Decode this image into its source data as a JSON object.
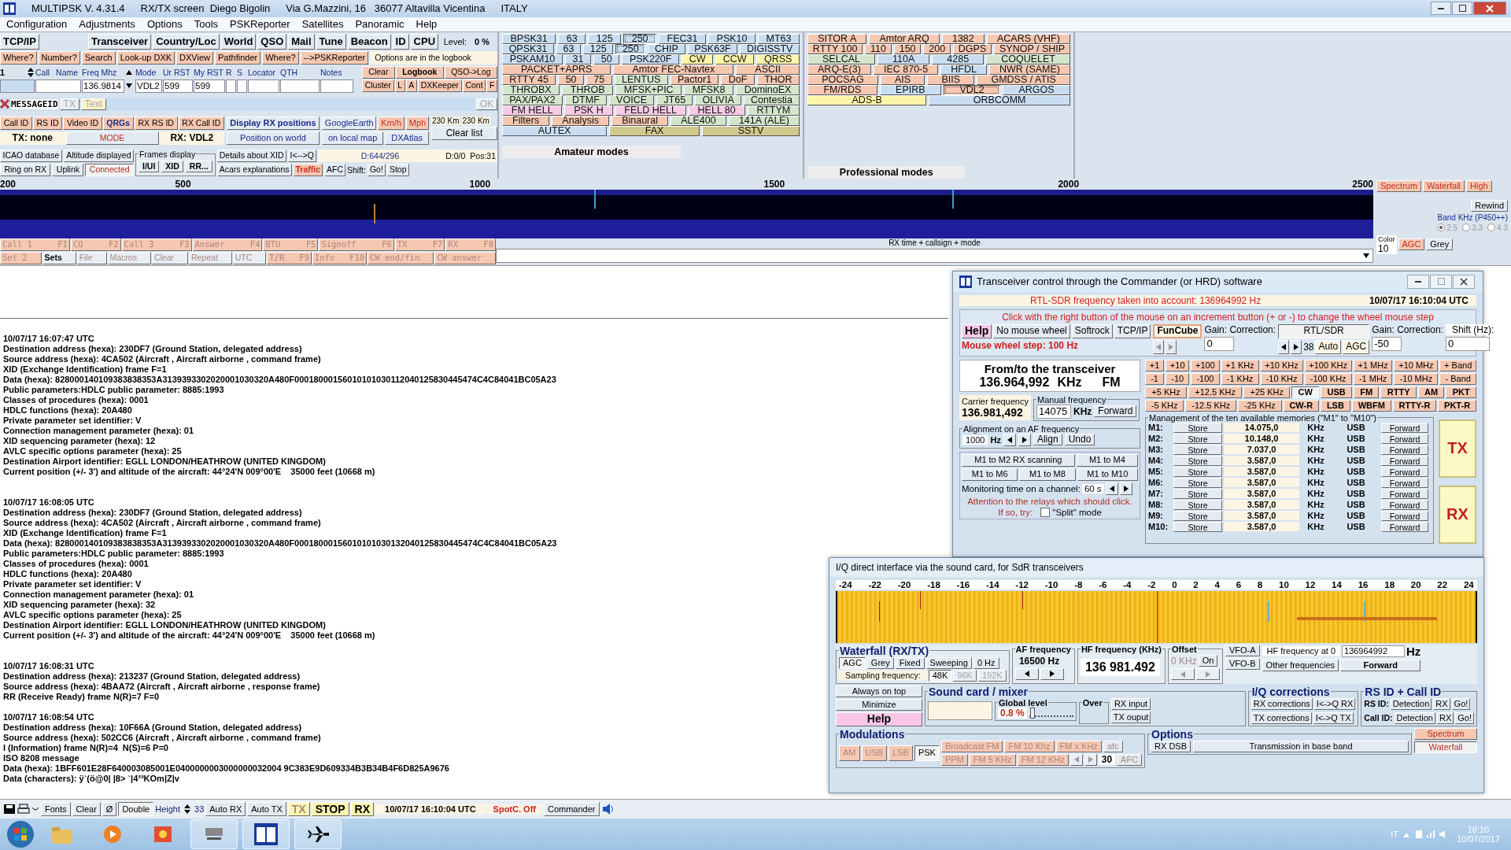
{
  "window": {
    "title_parts": [
      "MULTIPSK V. 4.31.4",
      "RX/TX screen  Diego Bigolin",
      "Via G.Mazzini, 16   36077 Altavilla Vicentina",
      "ITALY"
    ]
  },
  "menu": [
    "Configuration",
    "Adjustments",
    "Options",
    "Tools",
    "PSKReporter",
    "Satellites",
    "Panoramic",
    "Help"
  ],
  "toolbar": {
    "buttons": [
      "TCP/IP",
      "Transceiver",
      "Country/Loc",
      "World",
      "QSO",
      "Mail",
      "Tune",
      "Beacon",
      "ID",
      "CPU"
    ],
    "level_label": "Level:",
    "level_value": "0 %"
  },
  "log_buttons": [
    "Where?",
    "Number?",
    "Search",
    "Look-up DXK",
    "DXView",
    "Pathfinder",
    "Where?",
    "-->PSKReporter"
  ],
  "options_note": "Options are in the logbook",
  "qso": {
    "number": "1",
    "columns": [
      "Call",
      "Name",
      "Freq Mhz",
      "Mode",
      "Ur RST",
      "My RST",
      "R",
      "S",
      "Locator",
      "QTH",
      "Notes"
    ],
    "freq": "136.9814",
    "mode": "VDL2",
    "ur_rst": "599",
    "my_rst": "599"
  },
  "logbook_buttons": [
    [
      "Clear",
      "Logbook",
      "QSO->Log"
    ],
    [
      "Cluster",
      "L",
      "A",
      "DXKeeper",
      "Cont",
      "F"
    ]
  ],
  "message": {
    "label": "MESSAGEID",
    "tx": "TX",
    "text": "Text",
    "ok": "OK"
  },
  "id_buttons": [
    "Call ID",
    "RS ID",
    "Video ID",
    "QRGs",
    "RX RS ID",
    "RX Call ID"
  ],
  "tx_state": "TX: none",
  "mode_button": "MODE",
  "rx_state": "RX: VDL2",
  "map": {
    "display": "Display RX positions",
    "world": "Position on world",
    "google": "GoogleEarth",
    "kmh": "Km/h",
    "mph": "Mph",
    "local": "on local map",
    "dxatlas": "DXAtlas",
    "dist1": "230 Km",
    "dist2": "230 Km",
    "clear": "Clear list"
  },
  "frames": {
    "icao": "ICAO database",
    "altitude": "Altitude displayed",
    "ring": "Ring on RX",
    "uplink": "Uplink",
    "connected": "Connected",
    "title": "Frames display",
    "buttons": [
      "I/UI",
      "XID",
      "RR..."
    ],
    "details": "Details about XID",
    "iq": "I<-->Q",
    "acars": "Acars explanations",
    "traffic": "Traffic",
    "afc": "AFC",
    "shift": "Shift:",
    "go": "Go!",
    "stop": "Stop",
    "d1": "D:644/296",
    "d2": "D:0/0",
    "pos": "Pos:31"
  },
  "amateur": {
    "title": "Amateur modes",
    "rows": [
      {
        "buttons": [
          {
            "label": "BPSK31",
            "color": "#c9ddf2",
            "selected": false
          },
          {
            "label": "63",
            "color": "#c9ddf2",
            "selected": false
          },
          {
            "label": "125",
            "color": "#c9ddf2",
            "selected": false
          },
          {
            "label": "250",
            "color": "#c9ddf2",
            "selected": true
          },
          {
            "label": "FEC31",
            "color": "#c9ddf2",
            "selected": false
          },
          {
            "label": "PSK10",
            "color": "#c9ddf2",
            "selected": false
          },
          {
            "label": "MT63",
            "color": "#c9ddf2",
            "selected": false
          }
        ]
      },
      {
        "buttons": [
          {
            "label": "QPSK31",
            "color": "#c9ddf2",
            "selected": false
          },
          {
            "label": "63",
            "color": "#c9ddf2",
            "selected": false
          },
          {
            "label": "125",
            "color": "#c9ddf2",
            "selected": false
          },
          {
            "label": "250",
            "color": "#c9ddf2",
            "selected": true
          },
          {
            "label": "CHIP",
            "color": "#c9ddf2",
            "selected": false
          },
          {
            "label": "PSK63F",
            "color": "#c9ddf2",
            "selected": false
          },
          {
            "label": "DIGISSTV",
            "color": "#c9ddf2",
            "selected": false
          }
        ]
      },
      {
        "buttons": [
          {
            "label": "PSKAM10",
            "color": "#c9ddf2",
            "selected": false
          },
          {
            "label": "31",
            "color": "#c9ddf2",
            "selected": false
          },
          {
            "label": "50",
            "color": "#c9ddf2",
            "selected": false
          },
          {
            "label": "PSK220F",
            "color": "#c9ddf2",
            "selected": false
          },
          {
            "label": "CW",
            "color": "#fdf6a8",
            "selected": false
          },
          {
            "label": "CCW",
            "color": "#fdf6a8",
            "selected": false
          },
          {
            "label": "QRSS",
            "color": "#fdf6a8",
            "selected": false
          }
        ]
      },
      {
        "buttons": [
          {
            "label": "PACKET+APRS",
            "color": "#f6c7b1",
            "selected": false
          },
          {
            "label": "Amtor FEC-Navtex",
            "color": "#f6c7b1",
            "selected": false
          },
          {
            "label": "ASCII",
            "color": "#f6c7b1",
            "selected": false
          }
        ]
      },
      {
        "buttons": [
          {
            "label": "RTTY 45",
            "color": "#f6c7b1",
            "selected": false
          },
          {
            "label": "50",
            "color": "#f6c7b1",
            "selected": false
          },
          {
            "label": "75",
            "color": "#f6c7b1",
            "selected": false
          },
          {
            "label": "LENTUS",
            "color": "#d3e6cc",
            "selected": false
          },
          {
            "label": "Pactor1",
            "color": "#f6c7b1",
            "selected": false
          },
          {
            "label": "DoF",
            "color": "#f6c7b1",
            "selected": false
          },
          {
            "label": "THOR",
            "color": "#f6c7b1",
            "selected": false
          }
        ]
      },
      {
        "buttons": [
          {
            "label": "THROBX",
            "color": "#d3e6cc",
            "selected": false
          },
          {
            "label": "THROB",
            "color": "#d3e6cc",
            "selected": false
          },
          {
            "label": "MFSK+PIC",
            "color": "#d3e6cc",
            "selected": false
          },
          {
            "label": "MFSK8",
            "color": "#d3e6cc",
            "selected": false
          },
          {
            "label": "DominoEX",
            "color": "#d3e6cc",
            "selected": false
          }
        ]
      },
      {
        "buttons": [
          {
            "label": "PAX/PAX2",
            "color": "#d3e6cc",
            "selected": false
          },
          {
            "label": "DTMF",
            "color": "#d3e6cc",
            "selected": false
          },
          {
            "label": "VOICE",
            "color": "#d3e6cc",
            "selected": false
          },
          {
            "label": "JT65",
            "color": "#d3e6cc",
            "selected": false
          },
          {
            "label": "OLIVIA",
            "color": "#d3e6cc",
            "selected": false
          },
          {
            "label": "Contestia",
            "color": "#d3e6cc",
            "selected": false
          }
        ]
      },
      {
        "buttons": [
          {
            "label": "FM HELL",
            "color": "#f9cbe6",
            "selected": false
          },
          {
            "label": "PSK H",
            "color": "#f9cbe6",
            "selected": false
          },
          {
            "label": "FELD HELL",
            "color": "#f9cbe6",
            "selected": false
          },
          {
            "label": "HELL 80",
            "color": "#f9cbe6",
            "selected": false
          },
          {
            "label": "RTTYM",
            "color": "#d3e6cc",
            "selected": false
          }
        ]
      },
      {
        "buttons": [
          {
            "label": "Filters",
            "color": "#f6c7b1",
            "selected": false
          },
          {
            "label": "Analysis",
            "color": "#f6c7b1",
            "selected": false
          },
          {
            "label": "Binaural",
            "color": "#f6c7b1",
            "selected": false
          },
          {
            "label": "ALE400",
            "color": "#d3e6cc",
            "selected": false
          },
          {
            "label": "141A (ALE)",
            "color": "#d3e6cc",
            "selected": false
          }
        ]
      },
      {
        "buttons": [
          {
            "label": "AUTEX",
            "color": "#c9ddf2",
            "selected": false
          },
          {
            "label": "FAX",
            "color": "#d2c98f",
            "selected": false
          },
          {
            "label": "SSTV",
            "color": "#d2c98f",
            "selected": false
          }
        ]
      }
    ]
  },
  "professional": {
    "title": "Professional modes",
    "rows": [
      {
        "buttons": [
          {
            "label": "SITOR A",
            "color": "#f6c7b1",
            "selected": false
          },
          {
            "label": "Amtor ARQ",
            "color": "#f6c7b1",
            "selected": false
          },
          {
            "label": "1382",
            "color": "#f6c7b1",
            "selected": false
          },
          {
            "label": "ACARS (VHF)",
            "color": "#f6c7b1",
            "selected": false
          }
        ]
      },
      {
        "buttons": [
          {
            "label": "RTTY 100",
            "color": "#f6c7b1",
            "selected": false
          },
          {
            "label": "110",
            "color": "#f6c7b1",
            "selected": false
          },
          {
            "label": "150",
            "color": "#f6c7b1",
            "selected": false
          },
          {
            "label": "200",
            "color": "#f6c7b1",
            "selected": false
          },
          {
            "label": "DGPS",
            "color": "#f6c7b1",
            "selected": false
          },
          {
            "label": "SYNOP / SHIP",
            "color": "#f6c7b1",
            "selected": false
          }
        ]
      },
      {
        "buttons": [
          {
            "label": "SELCAL",
            "color": "#d3e6cc",
            "selected": false
          },
          {
            "label": "110A",
            "color": "#c9ddf2",
            "selected": false
          },
          {
            "label": "4285",
            "color": "#c9ddf2",
            "selected": false
          },
          {
            "label": "COQUELET",
            "color": "#d3e6cc",
            "selected": false
          }
        ]
      },
      {
        "buttons": [
          {
            "label": "ARQ-E(3)",
            "color": "#f6c7b1",
            "selected": false
          },
          {
            "label": "IEC 870-5",
            "color": "#f6c7b1",
            "selected": false
          },
          {
            "label": "HFDL",
            "color": "#c9ddf2",
            "selected": false
          },
          {
            "label": "NWR (SAME)",
            "color": "#f6c7b1",
            "selected": false
          }
        ]
      },
      {
        "buttons": [
          {
            "label": "POCSAG",
            "color": "#f6c7b1",
            "selected": false
          },
          {
            "label": "AIS",
            "color": "#f6c7b1",
            "selected": false
          },
          {
            "label": "BIIS",
            "color": "#f6c7b1",
            "selected": false
          },
          {
            "label": "GMDSS / ATIS",
            "color": "#f6c7b1",
            "selected": false
          }
        ]
      },
      {
        "buttons": [
          {
            "label": "FM/RDS",
            "color": "#f6c7b1",
            "selected": false
          },
          {
            "label": "EPIRB",
            "color": "#c9ddf2",
            "selected": false
          },
          {
            "label": "VDL2",
            "color": "#f6c7b1",
            "selected": true
          },
          {
            "label": "ARGOS",
            "color": "#c9ddf2",
            "selected": false
          }
        ]
      },
      {
        "buttons": [
          {
            "label": "ADS-B",
            "color": "#fdf6a8",
            "selected": false
          },
          {
            "label": "ORBCOMM",
            "color": "#c9ddf2",
            "selected": false
          }
        ]
      }
    ]
  },
  "scale": [
    "200",
    "500",
    "1000",
    "1500",
    "2000",
    "2500"
  ],
  "wf_side": {
    "views": [
      "Spectrum",
      "Waterfall",
      "High"
    ],
    "rewind": "Rewind",
    "band_label": "Band KHz (P450++)",
    "bands": [
      {
        "label": "2.5",
        "selected": true
      },
      {
        "label": "3.3",
        "selected": false
      },
      {
        "label": "4.3",
        "selected": false
      }
    ],
    "color_label": "Color",
    "color_value": "10",
    "agc": "AGC",
    "grey": "Grey"
  },
  "macros": [
    [
      {
        "label": "Call 1",
        "key": "F1"
      },
      {
        "label": "CQ",
        "key": "F2"
      },
      {
        "label": "Call 3",
        "key": "F3"
      },
      {
        "label": "Answer",
        "key": "F4"
      },
      {
        "label": "BTU",
        "key": "F5"
      },
      {
        "label": "Signoff",
        "key": "F6"
      },
      {
        "label": "TX",
        "key": "F7"
      },
      {
        "label": "RX",
        "key": "F8"
      }
    ],
    [
      {
        "label": "Set 2"
      },
      {
        "label": "Sets"
      },
      {
        "label": "File"
      },
      {
        "label": "Macros"
      },
      {
        "label": "Clear"
      },
      {
        "label": "Repeat"
      },
      {
        "label": "UTC"
      },
      {
        "label": "T/R",
        "key": "F9"
      },
      {
        "label": "Info",
        "key": "F10"
      },
      {
        "label": "CW end/fin"
      },
      {
        "label": "CW answer"
      }
    ]
  ],
  "rx_time_label": "RX time + callsign + mode",
  "log": [
    {
      "lines": [
        "10/07/17 16:07:47 UTC",
        "Destination address (hexa): 230DF7 (Ground Station, delegated address)",
        "Source address (hexa): 4CA502 (Aircraft , Aircraft airborne , command frame)",
        "XID (Exchange Identification) frame F=1",
        "Data (hexa): 828000140109383838353A3139393302020001030320A480F00018000156010101030112040125830445474C4C84041BC05A23",
        "Public parameters:HDLC public parameter: 8885:1993",
        "Classes of procedures (hexa): 0001",
        "HDLC functions (hexa): 20A480",
        "Private parameter set identifier: V",
        "Connection management parameter (hexa): 01",
        "XID sequencing parameter (hexa): 12",
        "AVLC specific options parameter (hexa): 25",
        "Destination Airport identifier: EGLL LONDON/HEATHROW (UNITED KINGDOM)",
        "Current position (+/- 3') and altitude of the aircraft: 44°24'N 009°00'E    35000 feet (10668 m)"
      ]
    },
    {
      "lines": [
        "10/07/17 16:08:05 UTC",
        "Destination address (hexa): 230DF7 (Ground Station, delegated address)",
        "Source address (hexa): 4CA502 (Aircraft , Aircraft airborne , command frame)",
        "XID (Exchange Identification) frame F=1",
        "Data (hexa): 828000140109383838353A3139393302020001030320A480F00018000156010101030132040125830445474C4C84041BC05A23",
        "Public parameters:HDLC public parameter: 8885:1993",
        "Classes of procedures (hexa): 0001",
        "HDLC functions (hexa): 20A480",
        "Private parameter set identifier: V",
        "Connection management parameter (hexa): 01",
        "XID sequencing parameter (hexa): 32",
        "AVLC specific options parameter (hexa): 25",
        "Destination Airport identifier: EGLL LONDON/HEATHROW (UNITED KINGDOM)",
        "Current position (+/- 3') and altitude of the aircraft: 44°24'N 009°00'E    35000 feet (10668 m)"
      ]
    },
    {
      "lines": [
        "10/07/17 16:08:31 UTC",
        "Destination address (hexa): 213237 (Ground Station, delegated address)",
        "Source address (hexa): 4BAA72 (Aircraft , Aircraft airborne , response frame)",
        "RR (Receive Ready) frame N(R)=7 F=0"
      ]
    },
    {
      "lines": [
        "10/07/17 16:08:54 UTC",
        "Destination address (hexa): 10F66A (Ground Station, delegated address)",
        "Source address (hexa): 502CC6 (Aircraft , Aircraft airborne , command frame)",
        "I (Information) frame N(R)=4  N(S)=6 P=0",
        "ISO 8208 message",
        "Data (hexa): 1BFF601E28F640003085001E0400000003000000032004 9C383E9D609334B3B34B4F6D825A9676",
        "Data (characters): ÿ`(ö@0| |8> `|4³³KOm|Z|v"
      ]
    }
  ],
  "transceiver": {
    "title": "Transceiver control through the Commander (or HRD) software",
    "rtl_info": "RTL-SDR frequency taken into account: 136964992 Hz",
    "datetime": "10/07/17 16:10:04 UTC",
    "hint": "Click with the right button of the mouse on an increment button (+ or -) to change the wheel mouse step",
    "help": "Help",
    "interfaces": [
      "No mouse wheel",
      "Softrock",
      "TCP/IP"
    ],
    "wheel_step": "Mouse wheel step: 100 Hz",
    "funcube": "FunCube",
    "gain_label": "Gain: Correction:",
    "gain_value": "0",
    "rtl": "RTL/SDR",
    "rtl_num": "38",
    "auto": "Auto",
    "agc": "AGC",
    "gain2_label": "Gain: Correction:",
    "gain2_value": "-50",
    "shift_label": "Shift (Hz):",
    "shift_value": "0",
    "from_to": "From/to the transceiver",
    "freq": "136.964,992",
    "freq_unit": "KHz",
    "mode": "FM",
    "carrier_label": "Carrier frequency",
    "carrier": "136.981,492",
    "manual_label": "Manual frequency",
    "manual_value": "14075",
    "manual_unit": "KHz",
    "forward": "Forward",
    "align_label": "Alignment on an AF frequency",
    "align_value": "1000",
    "align_unit": "Hz",
    "align": "Align",
    "undo": "Undo",
    "scan_buttons": [
      [
        "M1 to M2 RX scanning",
        "M1 to M4"
      ],
      [
        "M1 to M6",
        "M1 to M8",
        "M1 to M10"
      ]
    ],
    "monitor_label": "Monitoring time on a channel:",
    "monitor_value": "60 s",
    "attention": "Attention to the relays which should click.",
    "ifso": "If so, try:",
    "split": {
      "label": "\"Split\" mode",
      "checked": false
    },
    "inc_rows": [
      [
        "+1",
        "+10",
        "+100",
        "+1 KHz",
        "+10 KHz",
        "+100 KHz",
        "+1 MHz",
        "+10 MHz",
        "+ Band"
      ],
      [
        "-1",
        "-10",
        "-100",
        "-1 KHz",
        "-10 KHz",
        "-100 KHz",
        "-1 MHz",
        "-10 MHz",
        "- Band"
      ]
    ],
    "step_rows": [
      [
        "+5 KHz",
        "+12.5 KHz",
        "+25 KHz"
      ],
      [
        "-5 KHz",
        "-12.5 KHz",
        "-25 KHz"
      ]
    ],
    "mode_rows": [
      [
        {
          "label": "CW",
          "selected": true
        },
        {
          "label": "USB",
          "selected": false
        },
        {
          "label": "FM",
          "selected": false
        },
        {
          "label": "RTTY",
          "selected": false
        },
        {
          "label": "AM",
          "selected": false
        },
        {
          "label": "PKT",
          "selected": false
        }
      ],
      [
        {
          "label": "CW-R",
          "selected": false
        },
        {
          "label": "LSB",
          "selected": false
        },
        {
          "label": "WBFM",
          "selected": false
        },
        {
          "label": "RTTY-R",
          "selected": false
        },
        {
          "label": "PKT-R",
          "selected": false
        }
      ]
    ],
    "memories_label": "Management of the ten available memories (\"M1\" to \"M10\")",
    "memories": [
      {
        "id": "M1:",
        "store": "Store",
        "freq": "14.075,0",
        "unit": "KHz",
        "mode": "USB",
        "forward": "Forward"
      },
      {
        "id": "M2:",
        "store": "Store",
        "freq": "10.148,0",
        "unit": "KHz",
        "mode": "USB",
        "forward": "Forward"
      },
      {
        "id": "M3:",
        "store": "Store",
        "freq": "7.037,0",
        "unit": "KHz",
        "mode": "USB",
        "forward": "Forward"
      },
      {
        "id": "M4:",
        "store": "Store",
        "freq": "3.587,0",
        "unit": "KHz",
        "mode": "USB",
        "forward": "Forward"
      },
      {
        "id": "M5:",
        "store": "Store",
        "freq": "3.587,0",
        "unit": "KHz",
        "mode": "USB",
        "forward": "Forward"
      },
      {
        "id": "M6:",
        "store": "Store",
        "freq": "3.587,0",
        "unit": "KHz",
        "mode": "USB",
        "forward": "Forward"
      },
      {
        "id": "M7:",
        "store": "Store",
        "freq": "3.587,0",
        "unit": "KHz",
        "mode": "USB",
        "forward": "Forward"
      },
      {
        "id": "M8:",
        "store": "Store",
        "freq": "3.587,0",
        "unit": "KHz",
        "mode": "USB",
        "forward": "Forward"
      },
      {
        "id": "M9:",
        "store": "Store",
        "freq": "3.587,0",
        "unit": "KHz",
        "mode": "USB",
        "forward": "Forward"
      },
      {
        "id": "M10:",
        "store": "Store",
        "freq": "3.587,0",
        "unit": "KHz",
        "mode": "USB",
        "forward": "Forward"
      }
    ],
    "tx": "TX",
    "rx": "RX"
  },
  "iq": {
    "title": "I/Q direct interface via the sound card, for SdR transceivers",
    "scale": [
      "-24",
      "-22",
      "-20",
      "-18",
      "-16",
      "-14",
      "-12",
      "-10",
      "-8",
      "-6",
      "-4",
      "-2",
      "0",
      "2",
      "4",
      "6",
      "8",
      "10",
      "12",
      "14",
      "16",
      "18",
      "20",
      "22",
      "24"
    ],
    "waterfall_title": "Waterfall (RX/TX)",
    "wf_buttons": [
      {
        "label": "AGC",
        "selected": true
      },
      {
        "label": "Grey",
        "selected": false
      },
      {
        "label": "Fixed",
        "selected": false
      },
      {
        "label": "Sweeping",
        "selected": false
      },
      {
        "label": "0 Hz",
        "selected": false
      }
    ],
    "sampling_label": "Sampling frequency:",
    "sampling": [
      {
        "label": "48K",
        "selected": true
      },
      {
        "label": "96K",
        "selected": false
      },
      {
        "label": "192K",
        "selected": false
      }
    ],
    "af_label": "AF frequency",
    "af_value": "16500 Hz",
    "hf_label": "HF frequency (KHz)",
    "hf_value": "136 981.492",
    "offset_label": "Offset",
    "offset_value": "0 KHz",
    "on": "On",
    "vfo": [
      "VFO-A",
      "VFO-B"
    ],
    "hf0_label": "HF frequency at 0",
    "hf0_value": "136964992",
    "hz": "Hz",
    "other": "Other frequencies",
    "forward": "Forward",
    "always": "Always on top",
    "minimize": "Minimize",
    "help": "Help",
    "sound_title": "Sound card / mixer",
    "global": {
      "label": "Global level",
      "value": "0.8 %",
      "level": 0.03
    },
    "over": "Over",
    "rx_input": "RX input",
    "tx_output": "TX ouput",
    "iqc_title": "I/Q corrections",
    "iqc": [
      [
        "RX corrections",
        "I<->Q RX"
      ],
      [
        "TX corrections",
        "I<->Q TX"
      ]
    ],
    "rsid_title": "RS ID + Call ID",
    "rsid": [
      [
        "RS ID:",
        "Detection",
        "RX",
        "Go!"
      ],
      [
        "Call ID:",
        "Detection",
        "RX",
        "Go!"
      ]
    ],
    "mod_title": "Modulations",
    "mods": [
      {
        "label": "AM",
        "selected": false
      },
      {
        "label": "USB",
        "selected": false
      },
      {
        "label": "LSB",
        "selected": false
      },
      {
        "label": "PSK",
        "selected": true
      }
    ],
    "fm_rows": [
      [
        "Broadcast FM",
        "FM 10 Khz",
        "FM x KHz"
      ],
      [
        "PPM",
        "FM 5 KHz",
        "FM 12 KHz"
      ]
    ],
    "afc_small": "afc",
    "afc_value": "30",
    "afc": "AFC",
    "options_title": "Options",
    "rx_dsb": "RX DSB",
    "baseband": "Transmission in base band",
    "views": [
      {
        "label": "Spectrum",
        "selected": false
      },
      {
        "label": "Waterfall",
        "selected": true
      }
    ]
  },
  "status": {
    "fonts": "Fonts",
    "clear": "Clear",
    "zero": "Ø",
    "double": "Double",
    "height": "Height",
    "height_value": "33",
    "auto_rx": "Auto RX",
    "auto_tx": "Auto TX",
    "tx": "TX",
    "stop": "STOP",
    "rx": "RX",
    "datetime": "10/07/17 16:10:04 UTC",
    "spot": "SpotC. Off",
    "commander": "Commander"
  },
  "taskbar": {
    "lang": "IT",
    "time": "18:10",
    "date": "10/07/2017"
  }
}
